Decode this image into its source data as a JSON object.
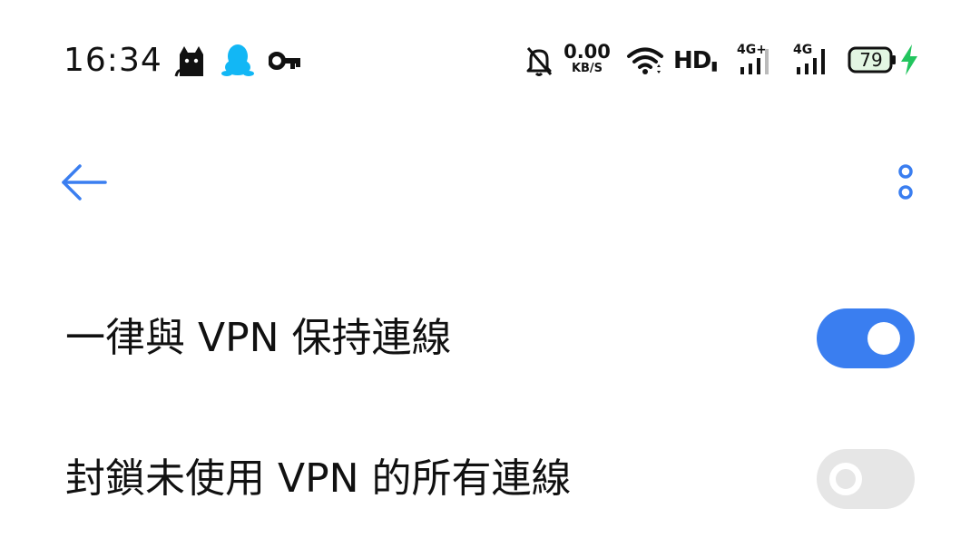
{
  "status_bar": {
    "time": "16:34",
    "left_icons": [
      "cat-icon",
      "qq-penguin-icon",
      "vpn-key-icon"
    ],
    "net_speed_value": "0.00",
    "net_speed_unit": "KB/S",
    "hd_label": "HD",
    "sim1_label": "4G+",
    "sim2_label": "4G",
    "battery_level": "79",
    "charging": true,
    "right_icons": [
      "bell-muted-icon",
      "wifi-icon",
      "signal-icon",
      "battery-icon",
      "charging-bolt-icon"
    ]
  },
  "app_bar": {
    "back_icon": "arrow-left-icon",
    "more_icon": "more-vertical-icon",
    "accent_color": "#3a7ef0"
  },
  "settings": [
    {
      "label": "一律與 VPN 保持連線",
      "enabled": true
    },
    {
      "label": "封鎖未使用 VPN 的所有連線",
      "enabled": false
    }
  ]
}
